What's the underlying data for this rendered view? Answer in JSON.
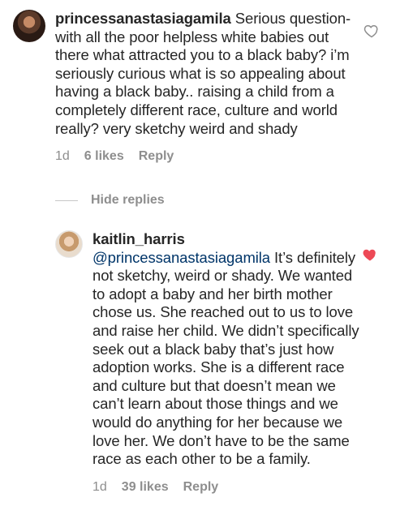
{
  "comments": [
    {
      "username": "princessanastasiagamila",
      "text": "Serious question- with all the poor helpless white babies out there what attracted you to a black baby? i’m seriously curious what is so appealing about having a black baby.. raising a child from a completely different race, culture and world really? very sketchy weird and shady",
      "time": "1d",
      "likes": "6 likes",
      "reply_label": "Reply",
      "liked": false
    }
  ],
  "hide_replies_label": "Hide replies",
  "replies": [
    {
      "username": "kaitlin_harris",
      "mention": "@princessanastasiagamila",
      "text": "It’s definitely not sketchy, weird or shady. We wanted to adopt a baby and her birth mother chose us. She reached out to us to love and raise her child. We didn’t specifically seek out a black baby that’s just how adoption works. She is a different race and culture but that doesn’t mean we can’t learn about those things and we would do anything for her because we love her. We don’t have to be the same race as each other to be a family.",
      "time": "1d",
      "likes": "39 likes",
      "reply_label": "Reply",
      "liked": true
    }
  ],
  "colors": {
    "text": "#262626",
    "meta": "#8e8e8e",
    "mention": "#003569",
    "heart_liked": "#ed4956",
    "heart_outline": "#8e8e8e"
  }
}
